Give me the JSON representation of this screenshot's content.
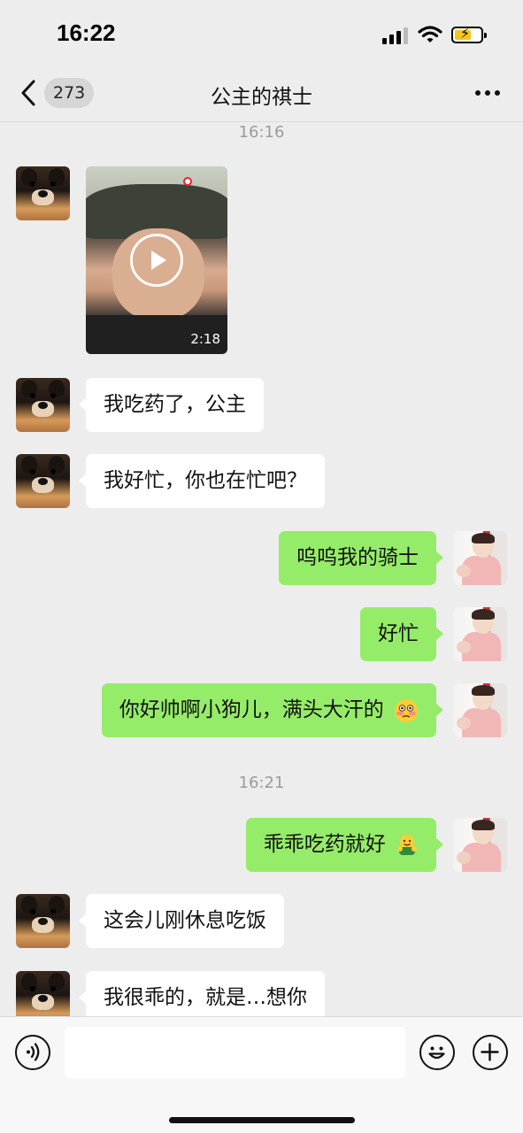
{
  "status_bar": {
    "time": "16:22"
  },
  "nav": {
    "back_badge": "273",
    "title": "公主的祺士"
  },
  "chat": {
    "timestamps": [
      "16:16",
      "16:21"
    ],
    "video": {
      "duration": "2:18"
    },
    "messages": [
      {
        "side": "in",
        "text": "我吃药了，公主"
      },
      {
        "side": "in",
        "text": "我好忙，你也在忙吧？"
      },
      {
        "side": "out",
        "text": "呜呜我的骑士"
      },
      {
        "side": "out",
        "text": "好忙"
      },
      {
        "side": "out",
        "text": "你好帅啊小狗儿，满头大汗的",
        "emoji": "flushed-face-emoji"
      },
      {
        "side": "out",
        "text": "乖乖吃药就好",
        "emoji": "hug-emoji"
      },
      {
        "side": "in",
        "text": "这会儿刚休息吃饭"
      },
      {
        "side": "in",
        "text": "我很乖的，就是…想你"
      }
    ]
  },
  "input_bar": {
    "placeholder": ""
  },
  "icons": {
    "back": "chevron-left-icon",
    "more": "more-dots-icon",
    "voice": "voice-icon",
    "emoji": "emoji-icon",
    "plus": "plus-icon"
  },
  "colors": {
    "out_bubble": "#95ec69",
    "in_bubble": "#ffffff",
    "background": "#ededed"
  }
}
